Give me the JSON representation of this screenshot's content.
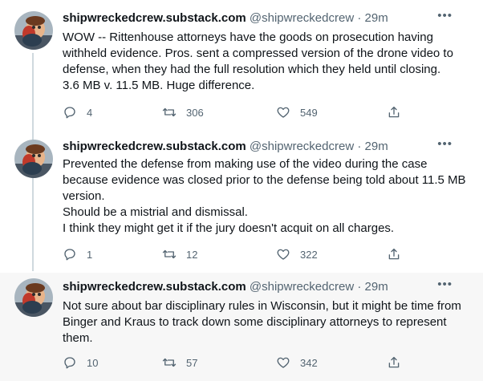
{
  "tweets": [
    {
      "name": "shipwreckedcrew.substack.com",
      "handle": "@shipwreckedcrew",
      "dot": "·",
      "time": "29m",
      "more_icon": "more-icon",
      "text": "WOW -- Rittenhouse attorneys have the goods on prosecution having withheld evidence.  Pros. sent a compressed version of the drone video to defense, when they had the full resolution which they held until closing.\n3.6 MB v. 11.5 MB.  Huge difference.",
      "replies": "4",
      "retweets": "306",
      "likes": "549"
    },
    {
      "name": "shipwreckedcrew.substack.com",
      "handle": "@shipwreckedcrew",
      "dot": "·",
      "time": "29m",
      "more_icon": "more-icon",
      "text": "Prevented  the defense from making use of the video during the case because evidence was closed prior to the defense being told about 11.5 MB version.\nShould be a mistrial and dismissal.\nI think they might get it if the jury doesn't acquit on all charges.",
      "replies": "1",
      "retweets": "12",
      "likes": "322"
    },
    {
      "name": "shipwreckedcrew.substack.com",
      "handle": "@shipwreckedcrew",
      "dot": "·",
      "time": "29m",
      "more_icon": "more-icon",
      "text": "Not sure about bar disciplinary rules in Wisconsin, but it might be time from Binger and Kraus to track down some disciplinary attorneys to represent them.",
      "replies": "10",
      "retweets": "57",
      "likes": "342"
    }
  ],
  "icons": {
    "reply": "reply-icon",
    "retweet": "retweet-icon",
    "like": "heart-icon",
    "share": "share-icon"
  },
  "colors": {
    "text": "#0f1419",
    "secondary": "#536471",
    "thread_line": "#cfd9de",
    "highlight_bg": "#f7f7f7"
  }
}
